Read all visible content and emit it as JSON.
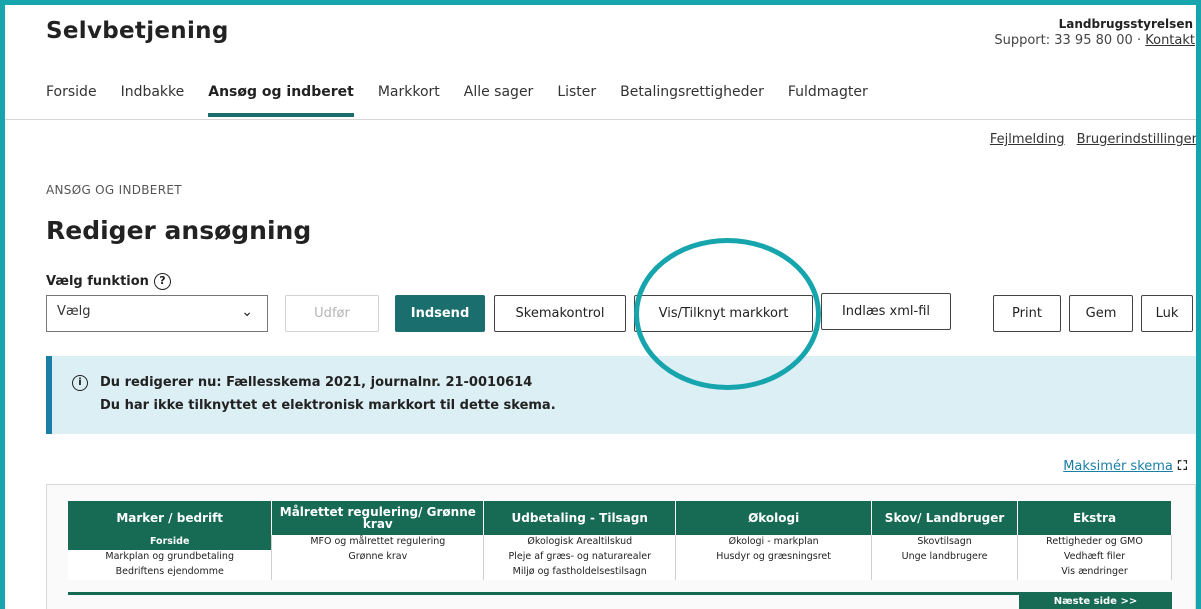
{
  "header": {
    "title": "Selvbetjening",
    "agency": "Landbrugsstyrelsen",
    "support_prefix": "Support: 33 95 80 00 · ",
    "contact_link": "Kontakt"
  },
  "nav": {
    "items": [
      {
        "label": "Forside"
      },
      {
        "label": "Indbakke"
      },
      {
        "label": "Ansøg og indberet",
        "active": true
      },
      {
        "label": "Markkort"
      },
      {
        "label": "Alle sager"
      },
      {
        "label": "Lister"
      },
      {
        "label": "Betalingsrettigheder"
      },
      {
        "label": "Fuldmagter"
      }
    ]
  },
  "util": {
    "error_report": "Fejlmelding",
    "user_settings": "Brugerindstillinger"
  },
  "breadcrumb": "ANSØG OG INDBERET",
  "page_title": "Rediger ansøgning",
  "function": {
    "label": "Vælg funktion",
    "select_value": "Vælg"
  },
  "buttons": {
    "execute": "Udfør",
    "submit": "Indsend",
    "schema_check": "Skemakontrol",
    "map_link": "Vis/Tilknyt markkort",
    "load_xml": "Indlæs xml-fil",
    "print": "Print",
    "save": "Gem",
    "close": "Luk"
  },
  "info": {
    "line1": "Du redigerer nu: Fællesskema 2021, journalnr. 21-0010614",
    "line2": "Du har ikke tilknyttet et elektronisk markkort til dette skema."
  },
  "maximize_link": "Maksimér skema",
  "schema": {
    "columns": [
      {
        "header": "Marker / bedrift",
        "items": [
          "Forside",
          "Markplan og grundbetaling",
          "Bedriftens ejendomme"
        ],
        "active_index": 0
      },
      {
        "header": "Målrettet regulering/ Grønne krav",
        "items": [
          "MFO og målrettet regulering",
          "Grønne krav"
        ]
      },
      {
        "header": "Udbetaling - Tilsagn",
        "items": [
          "Økologisk Arealtilskud",
          "Pleje af græs- og naturarealer",
          "Miljø og fastholdelsestilsagn"
        ]
      },
      {
        "header": "Økologi",
        "items": [
          "Økologi - markplan",
          "Husdyr og græsningsret"
        ]
      },
      {
        "header": "Skov/ Landbruger",
        "items": [
          "Skovtilsagn",
          "Unge landbrugere"
        ]
      },
      {
        "header": "Ekstra",
        "items": [
          "Rettigheder og GMO",
          "Vedhæft filer",
          "Vis ændringer"
        ]
      }
    ],
    "next_page": "Næste side >>"
  },
  "colors": {
    "accent_teal": "#17a5ad",
    "primary_green": "#1b6e6e",
    "schema_green": "#176b55",
    "info_bg": "#dceff5"
  }
}
